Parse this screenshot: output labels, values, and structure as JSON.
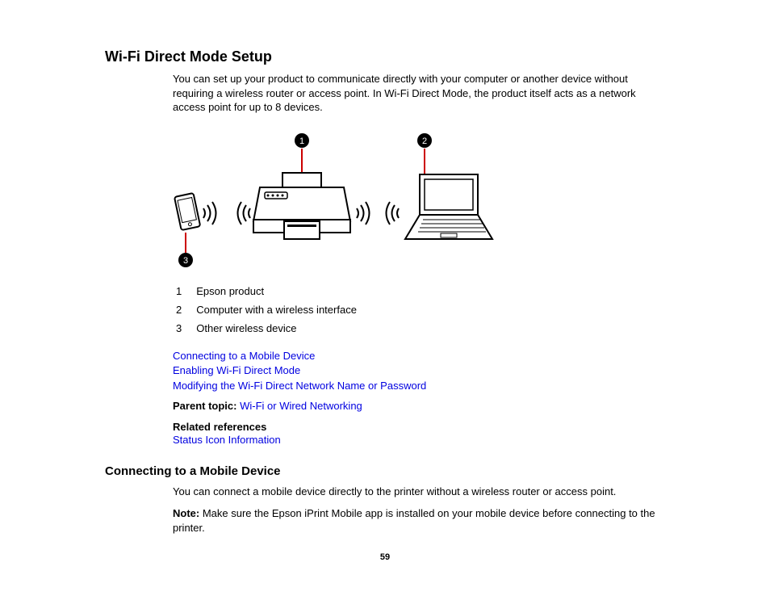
{
  "heading1": "Wi-Fi Direct Mode Setup",
  "intro": "You can set up your product to communicate directly with your computer or another device without requiring a wireless router or access point. In Wi-Fi Direct Mode, the product itself acts as a network access point for up to 8 devices.",
  "callouts": {
    "one": "1",
    "two": "2",
    "three": "3"
  },
  "legend": [
    {
      "num": "1",
      "text": "Epson product"
    },
    {
      "num": "2",
      "text": "Computer with a wireless interface"
    },
    {
      "num": "3",
      "text": "Other wireless device"
    }
  ],
  "links": [
    "Connecting to a Mobile Device",
    "Enabling Wi-Fi Direct Mode",
    "Modifying the Wi-Fi Direct Network Name or Password"
  ],
  "parent_topic_label": "Parent topic:",
  "parent_topic_link": "Wi-Fi or Wired Networking",
  "related_refs_label": "Related references",
  "related_refs_link": "Status Icon Information",
  "heading2": "Connecting to a Mobile Device",
  "section2_para": "You can connect a mobile device directly to the printer without a wireless router or access point.",
  "note_label": "Note:",
  "note_text": " Make sure the Epson iPrint Mobile app is installed on your mobile device before connecting to the printer.",
  "page_number": "59"
}
